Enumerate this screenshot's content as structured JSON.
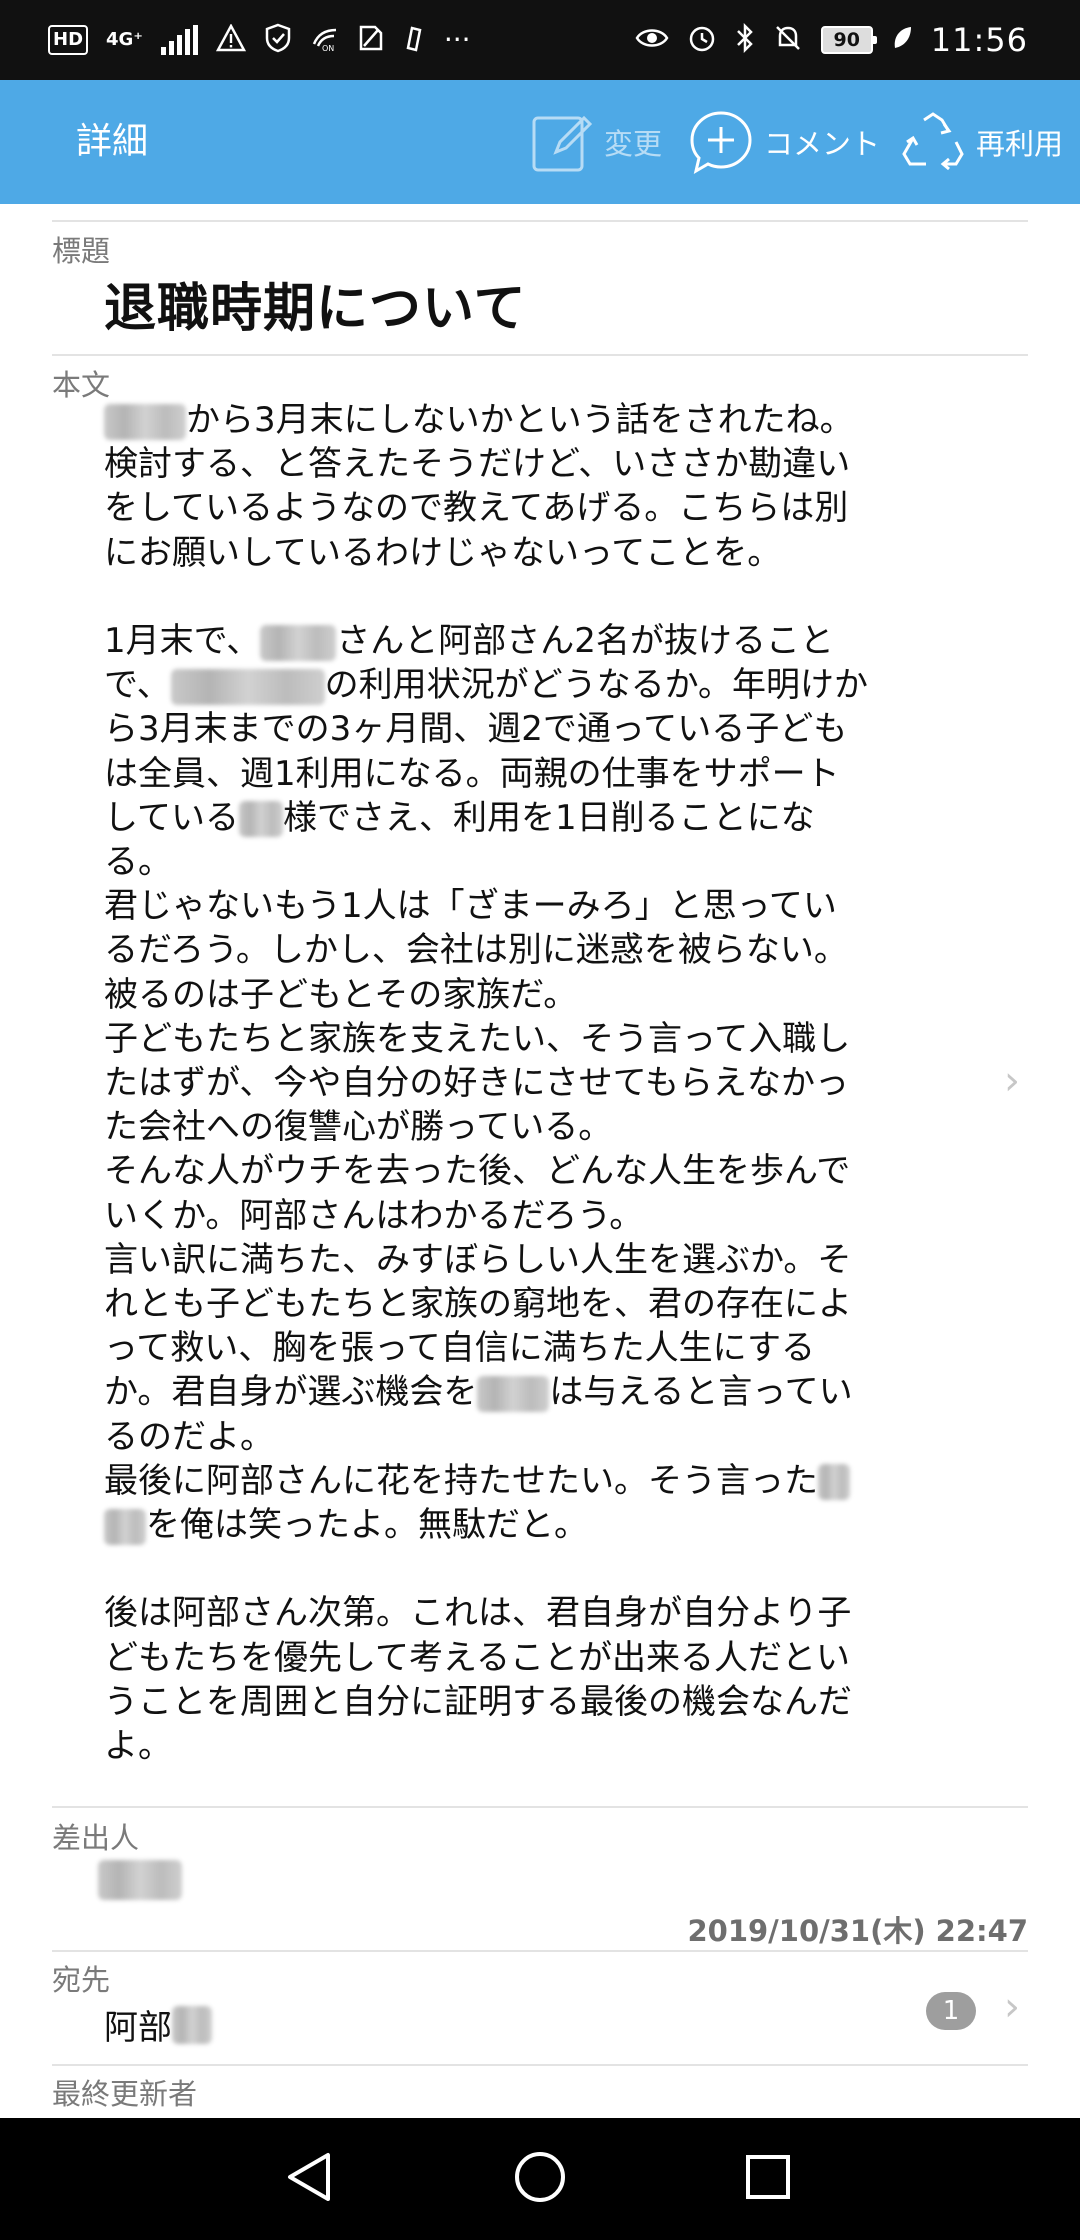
{
  "status_bar": {
    "hd": "HD",
    "network": "4G⁺",
    "battery": "90",
    "time": "11:56",
    "more": "···",
    "icons": [
      "hd-icon",
      "signal-icon",
      "warning-icon",
      "shield-icon",
      "nfc-icon",
      "no-sim-icon",
      "notification-icon",
      "eye-icon",
      "alarm-icon",
      "bluetooth-icon",
      "mute-icon",
      "battery-icon",
      "leaf-icon"
    ]
  },
  "app_bar": {
    "title": "詳細",
    "edit_label": "変更",
    "comment_label": "コメント",
    "reuse_label": "再利用",
    "color": "#4ea9e6"
  },
  "fields": {
    "subject_label": "標題",
    "subject": "退職時期について",
    "body_label": "本文",
    "sender_label": "差出人",
    "date": "2019/10/31(木) 22:47",
    "recipient_label": "宛先",
    "recipient": "阿部",
    "recipient_count": "1",
    "last_updated_label": "最終更新者"
  },
  "body": {
    "l1": "から3月末にしないかという話をされたね。",
    "l2": "検討する、と答えたそうだけど、いささか勘違い",
    "l3": "をしているようなので教えてあげる。こちらは別",
    "l4": "にお願いしているわけじゃないってことを。",
    "l5a": "1月末で、",
    "l5b": "さんと阿部さん2名が抜けること",
    "l6a": "で、",
    "l6b": "の利用状況がどうなるか。年明けか",
    "l7": "ら3月末までの3ヶ月間、週2で通っている子ども",
    "l8": "は全員、週1利用になる。両親の仕事をサポート",
    "l9a": "している",
    "l9b": "様でさえ、利用を1日削ることにな",
    "l10": "る。",
    "l11": "君じゃないもう1人は「ざまーみろ」と思ってい",
    "l12": "るだろう。しかし、会社は別に迷惑を被らない。",
    "l13": "被るのは子どもとその家族だ。",
    "l14": "子どもたちと家族を支えたい、そう言って入職し",
    "l15": "たはずが、今や自分の好きにさせてもらえなかっ",
    "l16": "た会社への復讐心が勝っている。",
    "l17": "そんな人がウチを去った後、どんな人生を歩んで",
    "l18": "いくか。阿部さんはわかるだろう。",
    "l19": "言い訳に満ちた、みすぼらしい人生を選ぶか。そ",
    "l20": "れとも子どもたちと家族の窮地を、君の存在によ",
    "l21": "って救い、胸を張って自信に満ちた人生にする",
    "l22a": "か。君自身が選ぶ機会を",
    "l22b": "は与えると言ってい",
    "l23": "るのだよ。",
    "l24": "最後に阿部さんに花を持たせたい。そう言った",
    "l25": "を俺は笑ったよ。無駄だと。",
    "l26": "後は阿部さん次第。これは、君自身が自分より子",
    "l27": "どもたちを優先して考えることが出来る人だとい",
    "l28": "うことを周囲と自分に証明する最後の機会なんだ",
    "l29": "よ。"
  },
  "chevrons": {
    "glyph": "›"
  }
}
